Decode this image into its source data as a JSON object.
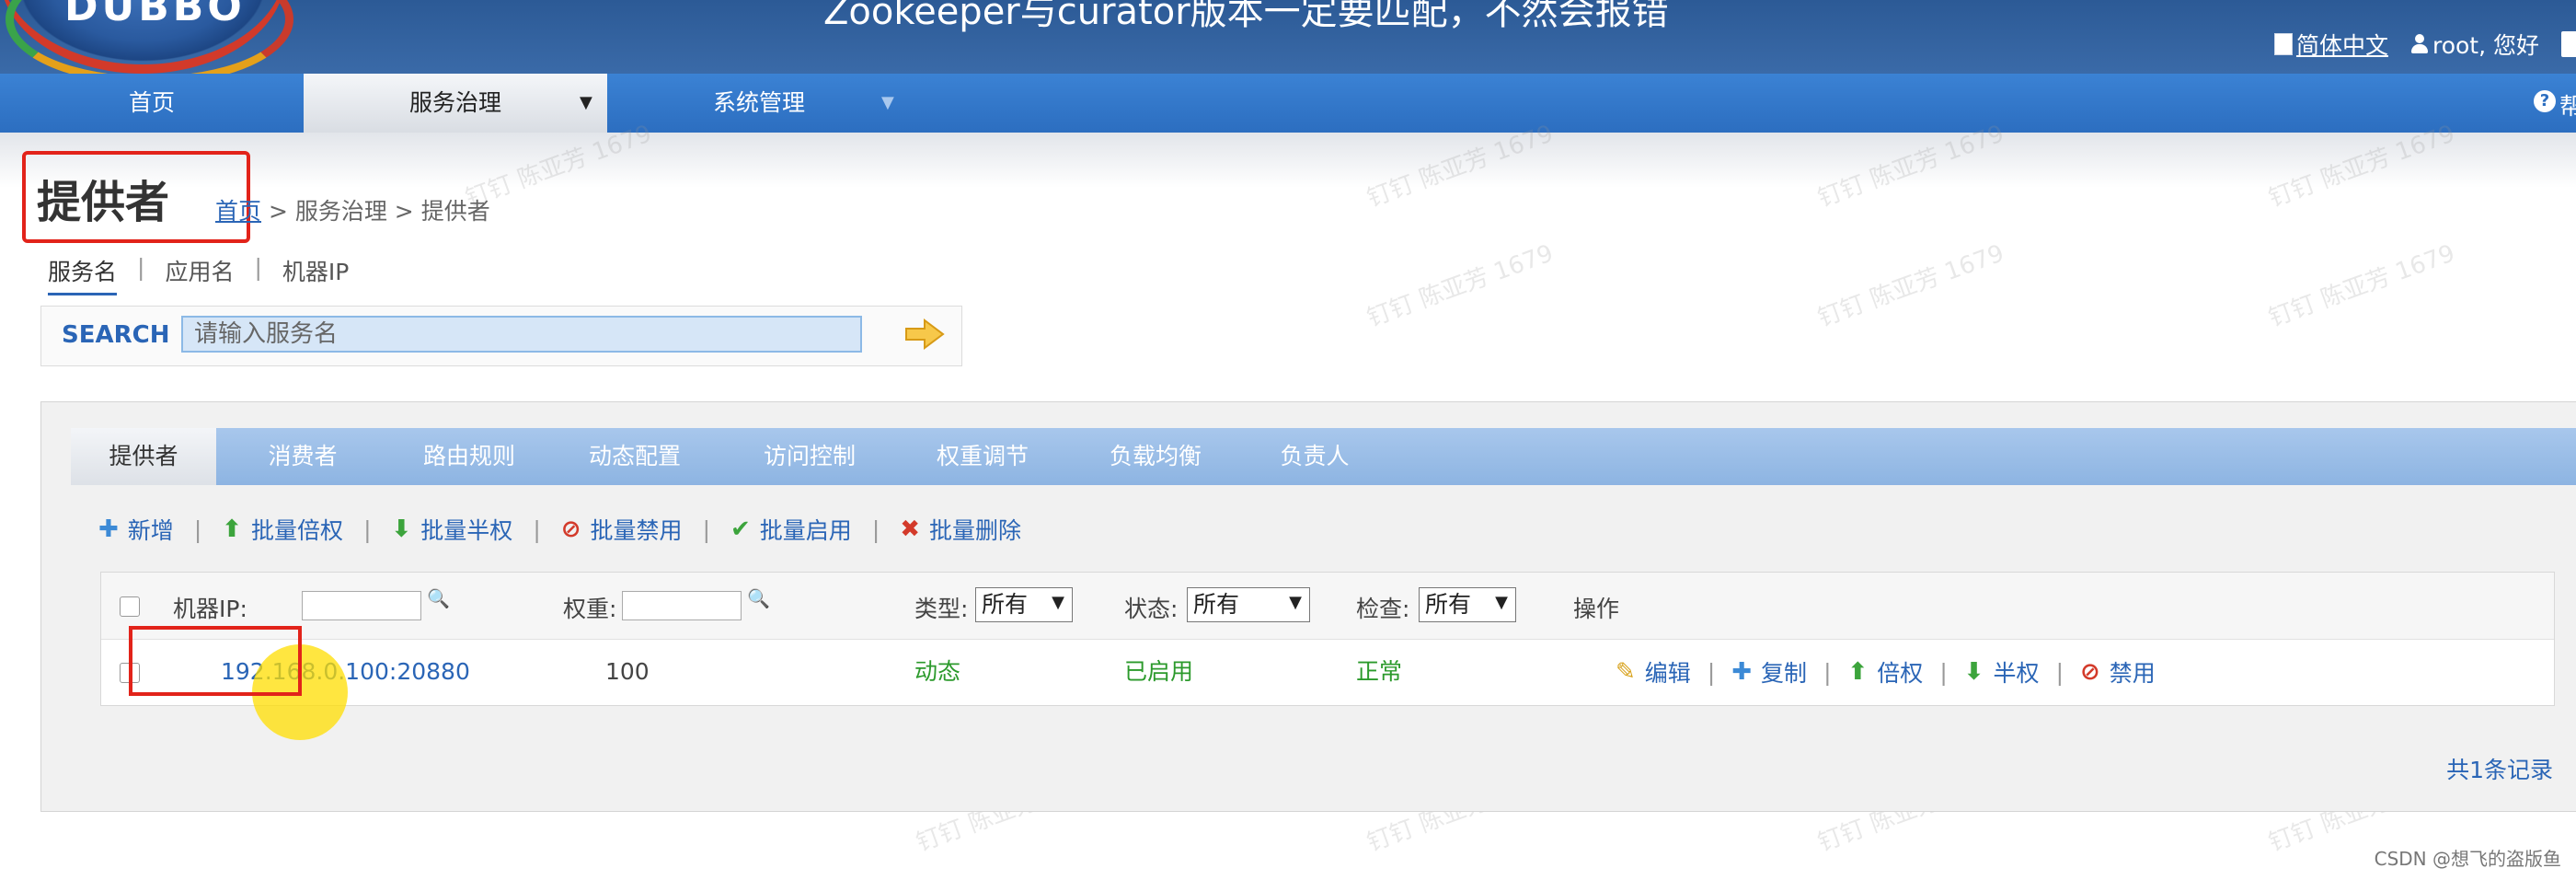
{
  "header": {
    "logo_text": "DUBBO",
    "video_caption": "Zookeeper与curator版本一定要匹配，不然会报错",
    "language_link": "简体中文",
    "user_greeting": "root, 您好"
  },
  "nav": {
    "items": [
      {
        "label": "首页"
      },
      {
        "label": "服务治理"
      },
      {
        "label": "系统管理"
      }
    ],
    "help_text": "帮"
  },
  "page": {
    "title": "提供者",
    "breadcrumb": {
      "home": "首页",
      "rest": " > 服务治理 > 提供者"
    },
    "subtabs": [
      "服务名",
      "应用名",
      "机器IP"
    ]
  },
  "search": {
    "label": "SEARCH",
    "placeholder": "请输入服务名"
  },
  "tabs": [
    "提供者",
    "消费者",
    "路由规则",
    "动态配置",
    "访问控制",
    "权重调节",
    "负载均衡",
    "负责人"
  ],
  "toolbar": {
    "add": "新增",
    "batch_double": "批量倍权",
    "batch_half": "批量半权",
    "batch_disable": "批量禁用",
    "batch_enable": "批量启用",
    "batch_delete": "批量删除"
  },
  "grid": {
    "headers": {
      "ip": "机器IP:",
      "weight": "权重:",
      "type": "类型:",
      "status": "状态:",
      "check": "检查:",
      "ops": "操作"
    },
    "filters": {
      "type": "所有",
      "status": "所有",
      "check": "所有"
    },
    "rows": [
      {
        "address": "192.168.0.100:20880",
        "weight": "100",
        "type": "动态",
        "status": "已启用",
        "check": "正常"
      }
    ],
    "row_ops": {
      "edit": "编辑",
      "copy": "复制",
      "double": "倍权",
      "half": "半权",
      "disable": "禁用"
    },
    "record_count": "共1条记录"
  },
  "watermark_text": "钉钉 陈亚芳 1679",
  "footer_credit": "CSDN @想飞的盗版鱼"
}
